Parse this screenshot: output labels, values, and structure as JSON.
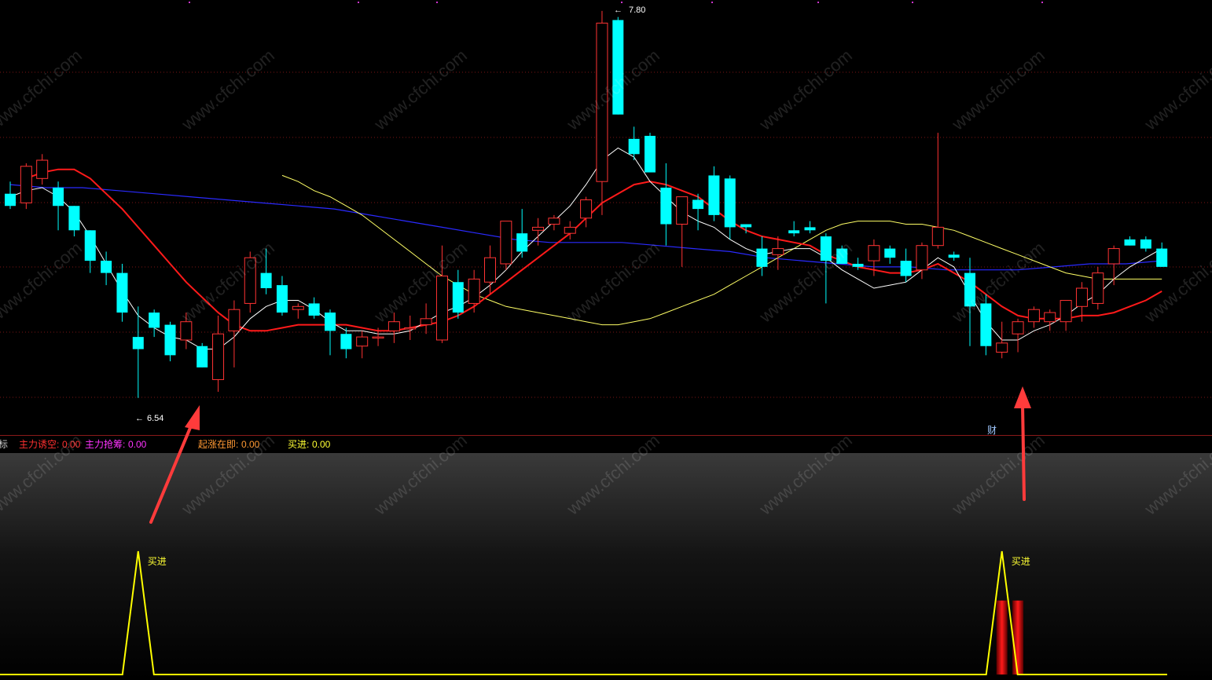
{
  "colors": {
    "up": "#ff3333",
    "down": "#00ffff",
    "ma_white": "#ffffff",
    "ma_red": "#ff1a1a",
    "ma_yellow": "#ffff66",
    "ma_blue": "#2a2aff",
    "indicator_line": "#ffff00",
    "arrow": "#ff3030",
    "grid": "#7a1515"
  },
  "main_chart": {
    "high_label": "7.80",
    "low_label": "6.54",
    "finance_marker": "财"
  },
  "indicator_bar": {
    "name_fragment": "指标",
    "lure_short_label": "主力诱空:",
    "lure_short_value": "0.00",
    "grab_chips_label": "主力抢筹:",
    "grab_chips_value": "0.00",
    "rising_label": "起涨在即:",
    "rising_value": "0.00",
    "buy_label": "买进:",
    "buy_value": "0.00"
  },
  "sub_chart": {
    "signal_label_1": "买进",
    "signal_label_2": "买进"
  },
  "watermark_text": "www.cfchi.com",
  "chart_data": {
    "type": "candlestick",
    "y_range": [
      6.48,
      7.82
    ],
    "candles": [
      {
        "o": 7.21,
        "h": 7.25,
        "l": 7.16,
        "c": 7.17
      },
      {
        "o": 7.18,
        "h": 7.31,
        "l": 7.16,
        "c": 7.3
      },
      {
        "o": 7.26,
        "h": 7.34,
        "l": 7.24,
        "c": 7.32
      },
      {
        "o": 7.23,
        "h": 7.25,
        "l": 7.09,
        "c": 7.17
      },
      {
        "o": 7.17,
        "h": 7.17,
        "l": 7.07,
        "c": 7.09
      },
      {
        "o": 7.09,
        "h": 7.09,
        "l": 6.95,
        "c": 6.99
      },
      {
        "o": 6.99,
        "h": 7.02,
        "l": 6.91,
        "c": 6.95
      },
      {
        "o": 6.95,
        "h": 6.98,
        "l": 6.79,
        "c": 6.82
      },
      {
        "o": 6.74,
        "h": 6.84,
        "l": 6.54,
        "c": 6.7
      },
      {
        "o": 6.82,
        "h": 6.83,
        "l": 6.74,
        "c": 6.77
      },
      {
        "o": 6.78,
        "h": 6.79,
        "l": 6.66,
        "c": 6.68
      },
      {
        "o": 6.73,
        "h": 6.82,
        "l": 6.7,
        "c": 6.79
      },
      {
        "o": 6.71,
        "h": 6.72,
        "l": 6.64,
        "c": 6.64
      },
      {
        "o": 6.6,
        "h": 6.81,
        "l": 6.56,
        "c": 6.75
      },
      {
        "o": 6.76,
        "h": 6.86,
        "l": 6.64,
        "c": 6.83
      },
      {
        "o": 6.85,
        "h": 7.02,
        "l": 6.82,
        "c": 7.0
      },
      {
        "o": 6.95,
        "h": 7.03,
        "l": 6.88,
        "c": 6.9
      },
      {
        "o": 6.91,
        "h": 6.94,
        "l": 6.81,
        "c": 6.82
      },
      {
        "o": 6.83,
        "h": 6.85,
        "l": 6.8,
        "c": 6.84
      },
      {
        "o": 6.85,
        "h": 6.87,
        "l": 6.8,
        "c": 6.81
      },
      {
        "o": 6.82,
        "h": 6.83,
        "l": 6.68,
        "c": 6.76
      },
      {
        "o": 6.75,
        "h": 6.77,
        "l": 6.67,
        "c": 6.7
      },
      {
        "o": 6.71,
        "h": 6.76,
        "l": 6.67,
        "c": 6.74
      },
      {
        "o": 6.74,
        "h": 6.77,
        "l": 6.71,
        "c": 6.74
      },
      {
        "o": 6.76,
        "h": 6.82,
        "l": 6.72,
        "c": 6.79
      },
      {
        "o": 6.77,
        "h": 6.81,
        "l": 6.73,
        "c": 6.77
      },
      {
        "o": 6.78,
        "h": 6.85,
        "l": 6.75,
        "c": 6.8
      },
      {
        "o": 6.73,
        "h": 7.04,
        "l": 6.72,
        "c": 6.94
      },
      {
        "o": 6.92,
        "h": 6.96,
        "l": 6.8,
        "c": 6.82
      },
      {
        "o": 6.85,
        "h": 6.96,
        "l": 6.82,
        "c": 6.93
      },
      {
        "o": 6.92,
        "h": 7.04,
        "l": 6.88,
        "c": 7.0
      },
      {
        "o": 6.98,
        "h": 7.12,
        "l": 6.96,
        "c": 7.12
      },
      {
        "o": 7.08,
        "h": 7.16,
        "l": 7.0,
        "c": 7.02
      },
      {
        "o": 7.09,
        "h": 7.13,
        "l": 7.04,
        "c": 7.1
      },
      {
        "o": 7.11,
        "h": 7.14,
        "l": 7.09,
        "c": 7.13
      },
      {
        "o": 7.08,
        "h": 7.12,
        "l": 7.06,
        "c": 7.1
      },
      {
        "o": 7.13,
        "h": 7.2,
        "l": 7.1,
        "c": 7.19
      },
      {
        "o": 7.25,
        "h": 7.81,
        "l": 7.14,
        "c": 7.77
      },
      {
        "o": 7.78,
        "h": 7.79,
        "l": 7.47,
        "c": 7.47
      },
      {
        "o": 7.39,
        "h": 7.43,
        "l": 7.32,
        "c": 7.34
      },
      {
        "o": 7.4,
        "h": 7.41,
        "l": 7.28,
        "c": 7.28
      },
      {
        "o": 7.23,
        "h": 7.31,
        "l": 7.04,
        "c": 7.11
      },
      {
        "o": 7.11,
        "h": 7.2,
        "l": 6.97,
        "c": 7.2
      },
      {
        "o": 7.19,
        "h": 7.21,
        "l": 7.09,
        "c": 7.16
      },
      {
        "o": 7.27,
        "h": 7.3,
        "l": 7.12,
        "c": 7.14
      },
      {
        "o": 7.26,
        "h": 7.27,
        "l": 7.06,
        "c": 7.1
      },
      {
        "o": 7.11,
        "h": 7.11,
        "l": 7.08,
        "c": 7.1
      },
      {
        "o": 7.03,
        "h": 7.07,
        "l": 6.94,
        "c": 6.97
      },
      {
        "o": 7.01,
        "h": 7.07,
        "l": 6.96,
        "c": 7.03
      },
      {
        "o": 7.09,
        "h": 7.12,
        "l": 7.07,
        "c": 7.08
      },
      {
        "o": 7.1,
        "h": 7.12,
        "l": 7.08,
        "c": 7.09
      },
      {
        "o": 7.07,
        "h": 7.08,
        "l": 6.85,
        "c": 6.99
      },
      {
        "o": 7.03,
        "h": 7.04,
        "l": 6.98,
        "c": 6.98
      },
      {
        "o": 6.98,
        "h": 7.0,
        "l": 6.96,
        "c": 6.97
      },
      {
        "o": 6.99,
        "h": 7.06,
        "l": 6.94,
        "c": 7.04
      },
      {
        "o": 7.03,
        "h": 7.04,
        "l": 6.98,
        "c": 7.0
      },
      {
        "o": 6.99,
        "h": 7.03,
        "l": 6.92,
        "c": 6.94
      },
      {
        "o": 6.96,
        "h": 7.05,
        "l": 6.93,
        "c": 7.04
      },
      {
        "o": 7.04,
        "h": 7.41,
        "l": 7.03,
        "c": 7.1
      },
      {
        "o": 7.01,
        "h": 7.02,
        "l": 6.99,
        "c": 7.0
      },
      {
        "o": 6.95,
        "h": 7.0,
        "l": 6.71,
        "c": 6.84
      },
      {
        "o": 6.85,
        "h": 6.88,
        "l": 6.68,
        "c": 6.71
      },
      {
        "o": 6.69,
        "h": 6.79,
        "l": 6.67,
        "c": 6.72
      },
      {
        "o": 6.75,
        "h": 6.8,
        "l": 6.69,
        "c": 6.79
      },
      {
        "o": 6.79,
        "h": 6.84,
        "l": 6.77,
        "c": 6.83
      },
      {
        "o": 6.79,
        "h": 6.83,
        "l": 6.76,
        "c": 6.82
      },
      {
        "o": 6.79,
        "h": 6.85,
        "l": 6.76,
        "c": 6.86
      },
      {
        "o": 6.84,
        "h": 6.92,
        "l": 6.79,
        "c": 6.9
      },
      {
        "o": 6.85,
        "h": 6.97,
        "l": 6.83,
        "c": 6.95
      },
      {
        "o": 6.98,
        "h": 7.04,
        "l": 6.91,
        "c": 7.03
      },
      {
        "o": 7.06,
        "h": 7.07,
        "l": 7.04,
        "c": 7.04
      },
      {
        "o": 7.06,
        "h": 7.07,
        "l": 7.02,
        "c": 7.03
      },
      {
        "o": 7.03,
        "h": 7.05,
        "l": 6.97,
        "c": 6.97
      }
    ],
    "ma_white": [
      7.2,
      7.22,
      7.23,
      7.2,
      7.15,
      7.07,
      6.98,
      6.89,
      6.81,
      6.77,
      6.74,
      6.73,
      6.7,
      6.7,
      6.74,
      6.8,
      6.84,
      6.86,
      6.86,
      6.83,
      6.79,
      6.76,
      6.76,
      6.75,
      6.75,
      6.76,
      6.79,
      6.82,
      6.84,
      6.87,
      6.91,
      6.96,
      7.02,
      7.07,
      7.12,
      7.17,
      7.24,
      7.32,
      7.36,
      7.33,
      7.25,
      7.2,
      7.15,
      7.12,
      7.1,
      7.06,
      7.03,
      7.01,
      7.02,
      7.03,
      7.03,
      7.0,
      6.96,
      6.93,
      6.9,
      6.91,
      6.92,
      6.96,
      7.0,
      6.97,
      6.88,
      6.79,
      6.73,
      6.73,
      6.76,
      6.78,
      6.81,
      6.85,
      6.88,
      6.93,
      6.97,
      7.0,
      7.03
    ],
    "ma_red": [
      7.26,
      7.28,
      7.29,
      7.29,
      7.26,
      7.21,
      7.16,
      7.1,
      7.04,
      6.98,
      6.92,
      6.87,
      6.82,
      6.78,
      6.76,
      6.76,
      6.77,
      6.78,
      6.78,
      6.78,
      6.78,
      6.77,
      6.76,
      6.76,
      6.77,
      6.78,
      6.79,
      6.81,
      6.84,
      6.88,
      6.92,
      6.96,
      7.0,
      7.04,
      7.08,
      7.13,
      7.18,
      7.21,
      7.24,
      7.25,
      7.24,
      7.22,
      7.2,
      7.16,
      7.12,
      7.09,
      7.07,
      7.06,
      7.05,
      7.04,
      7.01,
      6.99,
      6.97,
      6.96,
      6.95,
      6.95,
      6.96,
      6.98,
      6.95,
      6.92,
      6.88,
      6.84,
      6.81,
      6.8,
      6.8,
      6.8,
      6.81,
      6.81,
      6.82,
      6.84,
      6.86,
      6.89
    ],
    "ma_yellow": [
      7.27,
      7.25,
      7.22,
      7.2,
      7.17,
      7.14,
      7.1,
      7.06,
      7.02,
      6.98,
      6.94,
      6.91,
      6.88,
      6.86,
      6.84,
      6.83,
      6.82,
      6.81,
      6.8,
      6.79,
      6.78,
      6.78,
      6.79,
      6.8,
      6.82,
      6.84,
      6.86,
      6.88,
      6.91,
      6.94,
      6.97,
      7.0,
      7.03,
      7.06,
      7.09,
      7.11,
      7.12,
      7.12,
      7.12,
      7.11,
      7.11,
      7.1,
      7.09,
      7.07,
      7.05,
      7.03,
      7.01,
      6.99,
      6.97,
      6.95,
      6.94,
      6.93,
      6.93,
      6.93,
      6.93,
      6.93
    ],
    "ma_blue": [
      7.24,
      7.23,
      7.23,
      7.22,
      7.21,
      7.2,
      7.19,
      7.18,
      7.17,
      7.16,
      7.14,
      7.12,
      7.1,
      7.08,
      7.06,
      7.05,
      7.05,
      7.05,
      7.04,
      7.03,
      7.02,
      7.0,
      6.99,
      6.98,
      6.97,
      6.97,
      6.96,
      6.96,
      6.96,
      6.97,
      6.98,
      6.98,
      6.99
    ],
    "buy_signals": [
      8,
      62
    ],
    "red_bars": [
      {
        "index": 62,
        "value": 0.6
      },
      {
        "index": 63,
        "value": 0.6
      }
    ]
  }
}
